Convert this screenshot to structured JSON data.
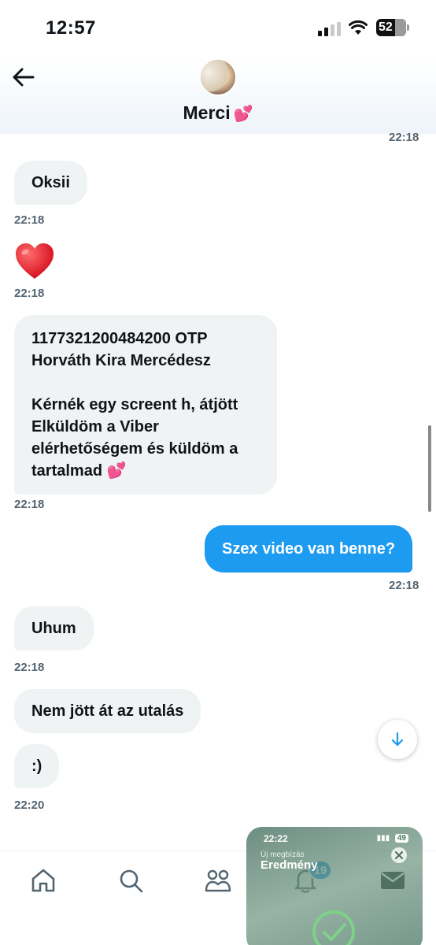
{
  "status_bar": {
    "time": "12:57",
    "battery": "52"
  },
  "header": {
    "contact_name": "Merci",
    "name_emoji": "💕"
  },
  "messages": [
    {
      "direction": "in",
      "time": "22:18",
      "top_time_only": true
    },
    {
      "direction": "in",
      "text": "Oksii",
      "time": "22:18"
    },
    {
      "direction": "in",
      "emoji": "heart",
      "time": "22:18"
    },
    {
      "direction": "in",
      "lines": [
        "1177321200484200 OTP",
        "Horváth Kira Mercédesz",
        "",
        "Kérnék egy screent h, átjött",
        "Elküldöm a Viber",
        "elérhetőségem és küldöm a",
        "tartalmad 💕"
      ],
      "time": "22:18"
    },
    {
      "direction": "out",
      "text": "Szex video van benne?",
      "time": "22:18"
    },
    {
      "direction": "in",
      "text": "Uhum",
      "time": "22:18"
    },
    {
      "direction": "in",
      "text": "Nem jött át az utalás"
    },
    {
      "direction": "in",
      "text": ":)",
      "time": "22:20"
    }
  ],
  "tab_bar": {
    "notification_badge": "19"
  },
  "pip_overlay": {
    "time": "22:22",
    "battery": "49",
    "subtitle": "Új megbízás",
    "title": "Eredmény"
  },
  "colors": {
    "accent": "#1d9bf0",
    "bubble_in": "#eff3f4",
    "muted": "#536471"
  }
}
